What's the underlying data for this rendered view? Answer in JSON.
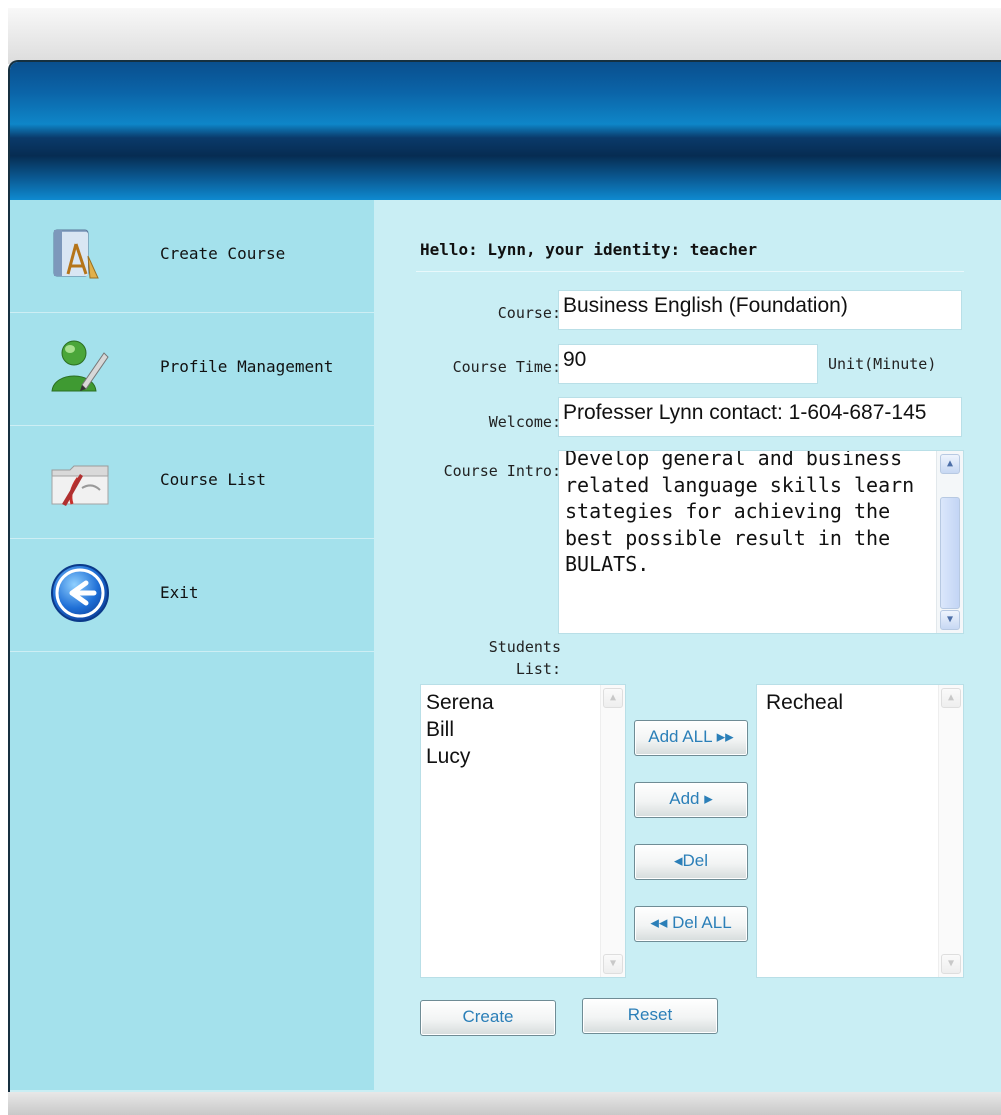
{
  "sidebar": {
    "items": [
      {
        "label": "Create Course",
        "icon": "create-course-icon"
      },
      {
        "label": "Profile Management",
        "icon": "user-profile-icon"
      },
      {
        "label": "Course List",
        "icon": "course-list-icon"
      },
      {
        "label": "Exit",
        "icon": "back-arrow-icon"
      }
    ]
  },
  "main": {
    "greeting": "Hello: Lynn, your identity: teacher",
    "course": {
      "label": "Course:",
      "value": "Business English (Foundation)"
    },
    "course_time": {
      "label": "Course Time:",
      "value": "90",
      "unit": "Unit(Minute)"
    },
    "welcome": {
      "label": "Welcome:",
      "value": "Professer Lynn contact: 1-604-687-145"
    },
    "course_intro": {
      "label": "Course Intro:",
      "value": "Develop general and business related language skills learn stategies for achieving the best possible result in the BULATS."
    },
    "students": {
      "label_line1": "Students",
      "label_line2": "List:",
      "available": [
        "Serena",
        "Bill",
        "Lucy"
      ],
      "selected": [
        "Recheal"
      ]
    },
    "buttons": {
      "add_all": "Add ALL ▸▸",
      "add": "Add ▸",
      "del": "◂Del",
      "del_all": "◂◂ Del ALL",
      "create": "Create",
      "reset": "Reset"
    }
  },
  "colors": {
    "banner": "#0a4f8e",
    "sidebar_bg": "#a4e1ec",
    "content_bg": "#c9eef4",
    "button_text": "#2b7fb8"
  }
}
